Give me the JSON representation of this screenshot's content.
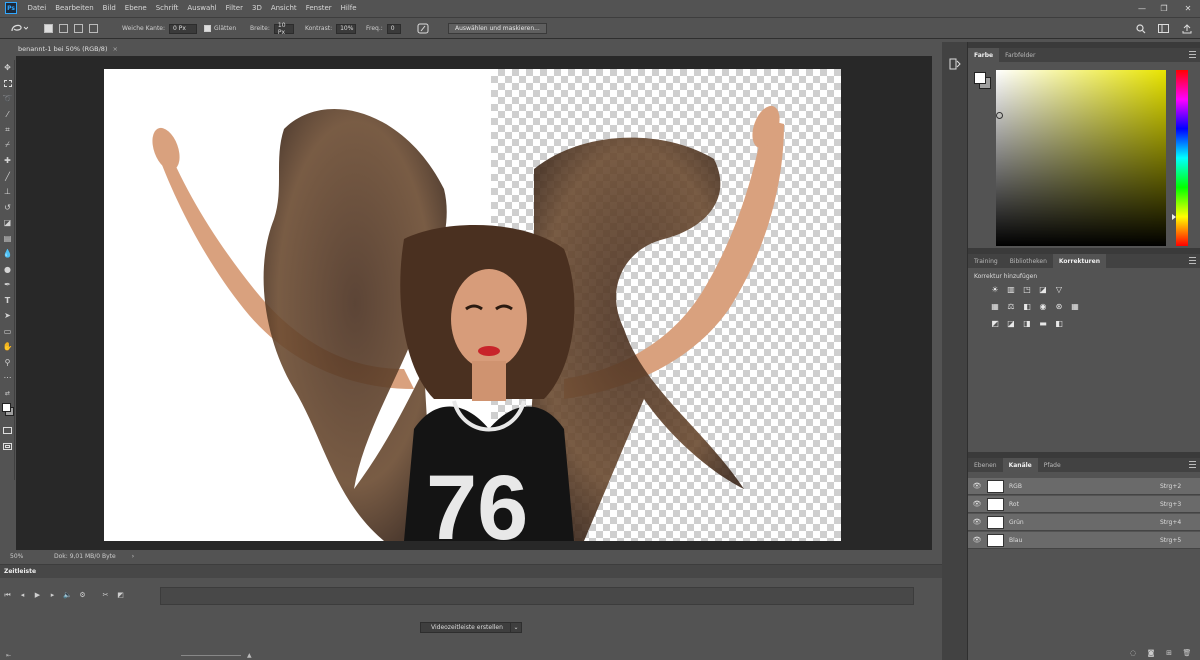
{
  "app": {
    "logo": "Ps"
  },
  "menu": [
    "Datei",
    "Bearbeiten",
    "Bild",
    "Ebene",
    "Schrift",
    "Auswahl",
    "Filter",
    "3D",
    "Ansicht",
    "Fenster",
    "Hilfe"
  ],
  "window_controls": {
    "minimize": "—",
    "restore": "❐",
    "close": "✕"
  },
  "options": {
    "feather_label": "Weiche Kante:",
    "feather_value": "0 Px",
    "antialias_label": "Glätten",
    "width_label": "Breite:",
    "width_value": "10 Px",
    "contrast_label": "Kontrast:",
    "contrast_value": "10%",
    "freq_label": "Freq.:",
    "freq_value": "0",
    "select_mask_button": "Auswählen und maskieren..."
  },
  "document": {
    "tab_title": "benannt-1 bei 50% (RGB/8)"
  },
  "status": {
    "zoom": "50%",
    "doc_info": "Dok: 9,01 MB/0 Byte"
  },
  "timeline": {
    "title": "Zeitleiste",
    "create_button": "Videozeitleiste erstellen"
  },
  "color_panel": {
    "tabs": [
      "Farbe",
      "Farbfelder"
    ],
    "active_tab": "Farbe",
    "foreground": "#ffffff",
    "background": "#a0a0a0"
  },
  "adjustments_panel": {
    "tabs": [
      "Training",
      "Bibliotheken",
      "Korrekturen"
    ],
    "active_tab": "Korrekturen",
    "title": "Korrektur hinzufügen",
    "rows": [
      [
        "brightness-icon",
        "levels-icon",
        "curves-icon",
        "exposure-icon",
        "vibrance-icon"
      ],
      [
        "hue-saturation-icon",
        "color-balance-icon",
        "black-white-icon",
        "photo-filter-icon",
        "channel-mixer-icon",
        "color-lookup-icon"
      ],
      [
        "invert-icon",
        "posterize-icon",
        "threshold-icon",
        "gradient-map-icon",
        "selective-color-icon"
      ]
    ]
  },
  "channels_panel": {
    "tabs": [
      "Ebenen",
      "Kanäle",
      "Pfade"
    ],
    "active_tab": "Kanäle",
    "channels": [
      {
        "name": "RGB",
        "shortcut": "Strg+2"
      },
      {
        "name": "Rot",
        "shortcut": "Strg+3"
      },
      {
        "name": "Grün",
        "shortcut": "Strg+4"
      },
      {
        "name": "Blau",
        "shortcut": "Strg+5"
      }
    ]
  }
}
